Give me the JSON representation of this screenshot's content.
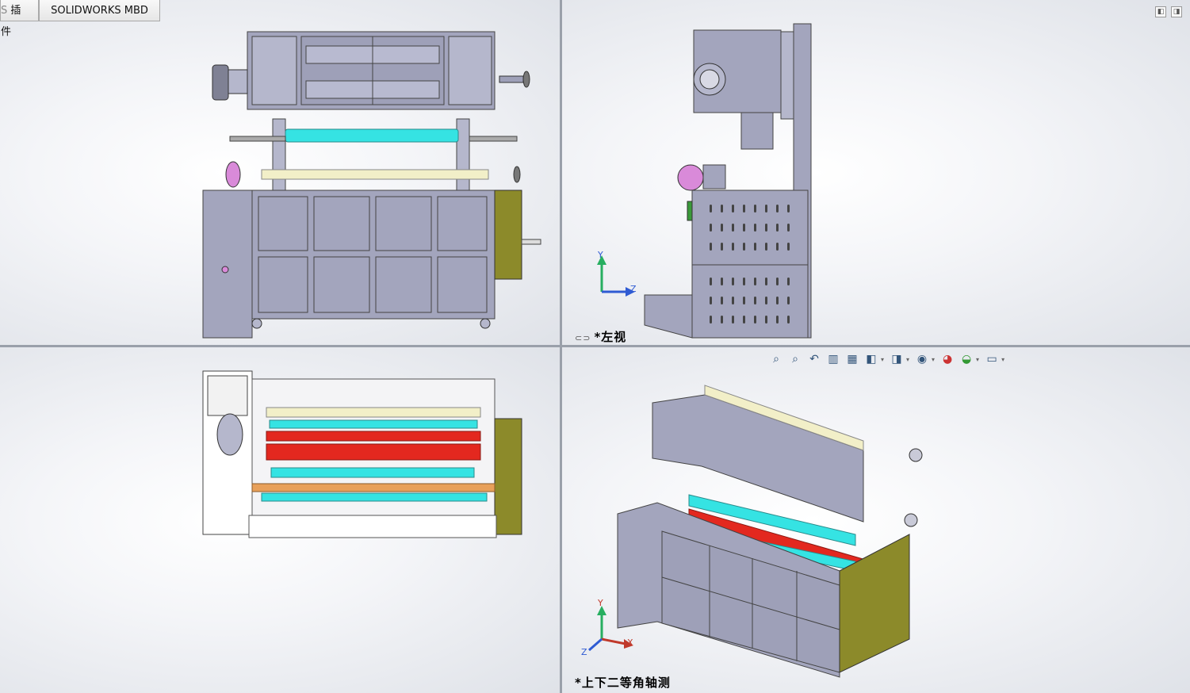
{
  "tabs": [
    {
      "label": "插件"
    },
    {
      "label": "SOLIDWORKS MBD"
    }
  ],
  "viewports": {
    "top_right": {
      "label": "*左视"
    },
    "bottom_right": {
      "label": "*上下二等角轴测"
    }
  },
  "axes": {
    "x": "X",
    "y": "Y",
    "z": "Z"
  },
  "hud_icons": [
    {
      "name": "zoom-to-fit-icon",
      "glyph": "🔍"
    },
    {
      "name": "zoom-to-area-icon",
      "glyph": "🔎"
    },
    {
      "name": "previous-view-icon",
      "glyph": "↶"
    },
    {
      "name": "section-view-icon",
      "glyph": "▥"
    },
    {
      "name": "dynamic-annotation-icon",
      "glyph": "▦"
    },
    {
      "name": "view-orientation-icon",
      "glyph": "◧"
    },
    {
      "name": "display-style-icon",
      "glyph": "◨"
    },
    {
      "name": "hide-show-items-icon",
      "glyph": "◉"
    },
    {
      "name": "edit-appearance-icon",
      "glyph": "◕"
    },
    {
      "name": "apply-scene-icon",
      "glyph": "◒"
    },
    {
      "name": "view-settings-icon",
      "glyph": "▭"
    }
  ],
  "colors": {
    "metal": "#a3a5bd",
    "metal_dark": "#8c8ea8",
    "olive": "#8c8a2a",
    "cyan_roller": "#35e3e3",
    "red_roller": "#e3281f",
    "cream_roller": "#f2efc8",
    "magenta": "#d98ad9",
    "axis_x": "#c0392b",
    "axis_y": "#27ae60",
    "axis_z": "#2f5bd3"
  }
}
